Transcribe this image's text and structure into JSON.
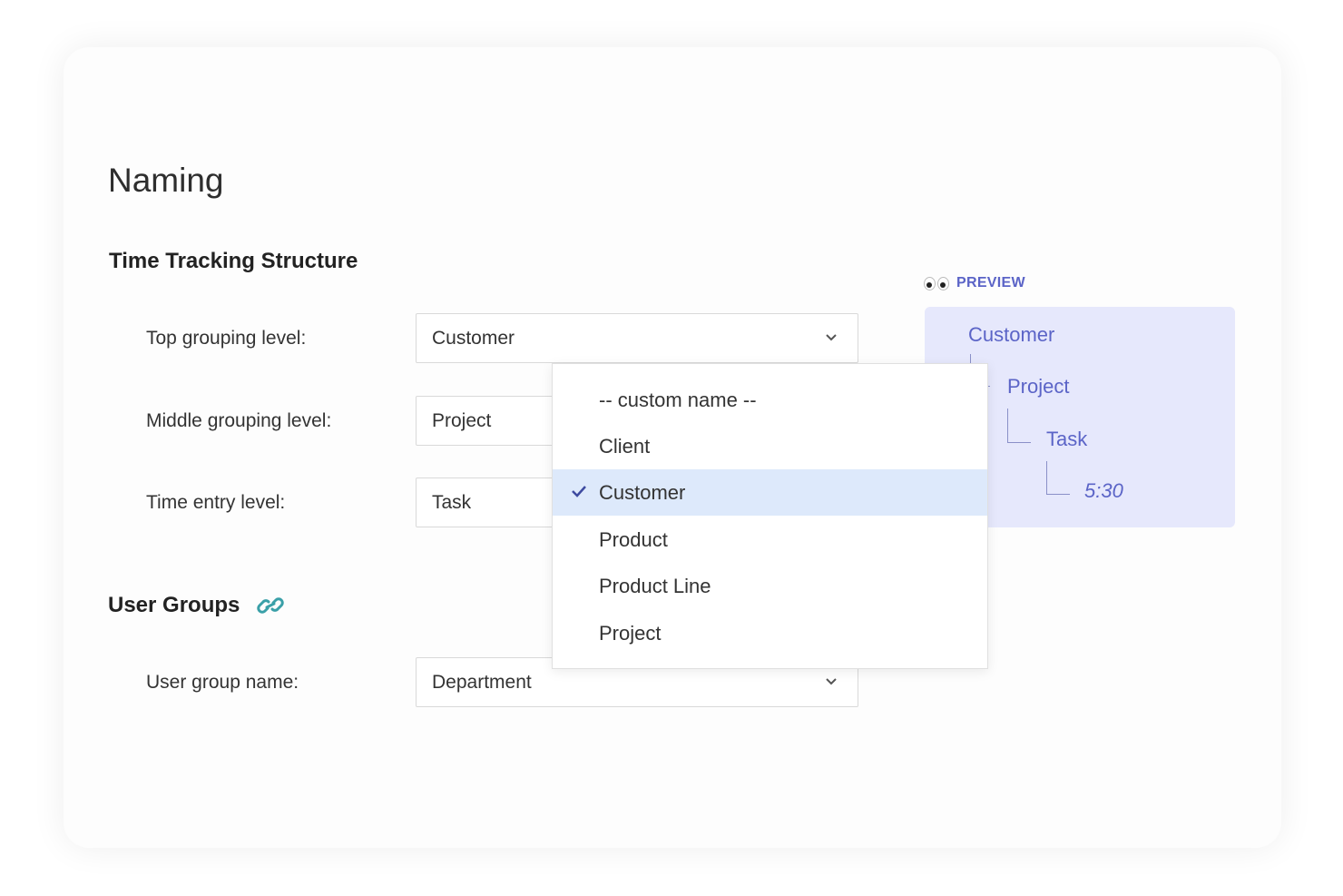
{
  "page": {
    "title": "Naming"
  },
  "time_tracking": {
    "title": "Time Tracking Structure",
    "fields": [
      {
        "label": "Top grouping level:",
        "value": "Customer"
      },
      {
        "label": "Middle grouping level:",
        "value": "Project"
      },
      {
        "label": "Time entry level:",
        "value": "Task"
      }
    ]
  },
  "user_groups": {
    "title": "User Groups",
    "field": {
      "label": "User group name:",
      "value": "Department"
    }
  },
  "preview": {
    "label": "PREVIEW",
    "top": "Customer",
    "middle": "Project",
    "entry": "Task",
    "time": "5:30"
  },
  "dropdown": {
    "options": [
      "-- custom name --",
      "Client",
      "Customer",
      "Product",
      "Product Line",
      "Project"
    ],
    "selected": "Customer"
  },
  "colors": {
    "accent": "#5b64c7",
    "preview_bg": "#e6e8fc",
    "selected_bg": "#dde9fb",
    "link_icon": "#3aa0a8"
  },
  "icons": {
    "link": "link-icon",
    "chevron": "chevron-down-icon",
    "check": "check-icon",
    "eyes": "eyes-icon"
  }
}
